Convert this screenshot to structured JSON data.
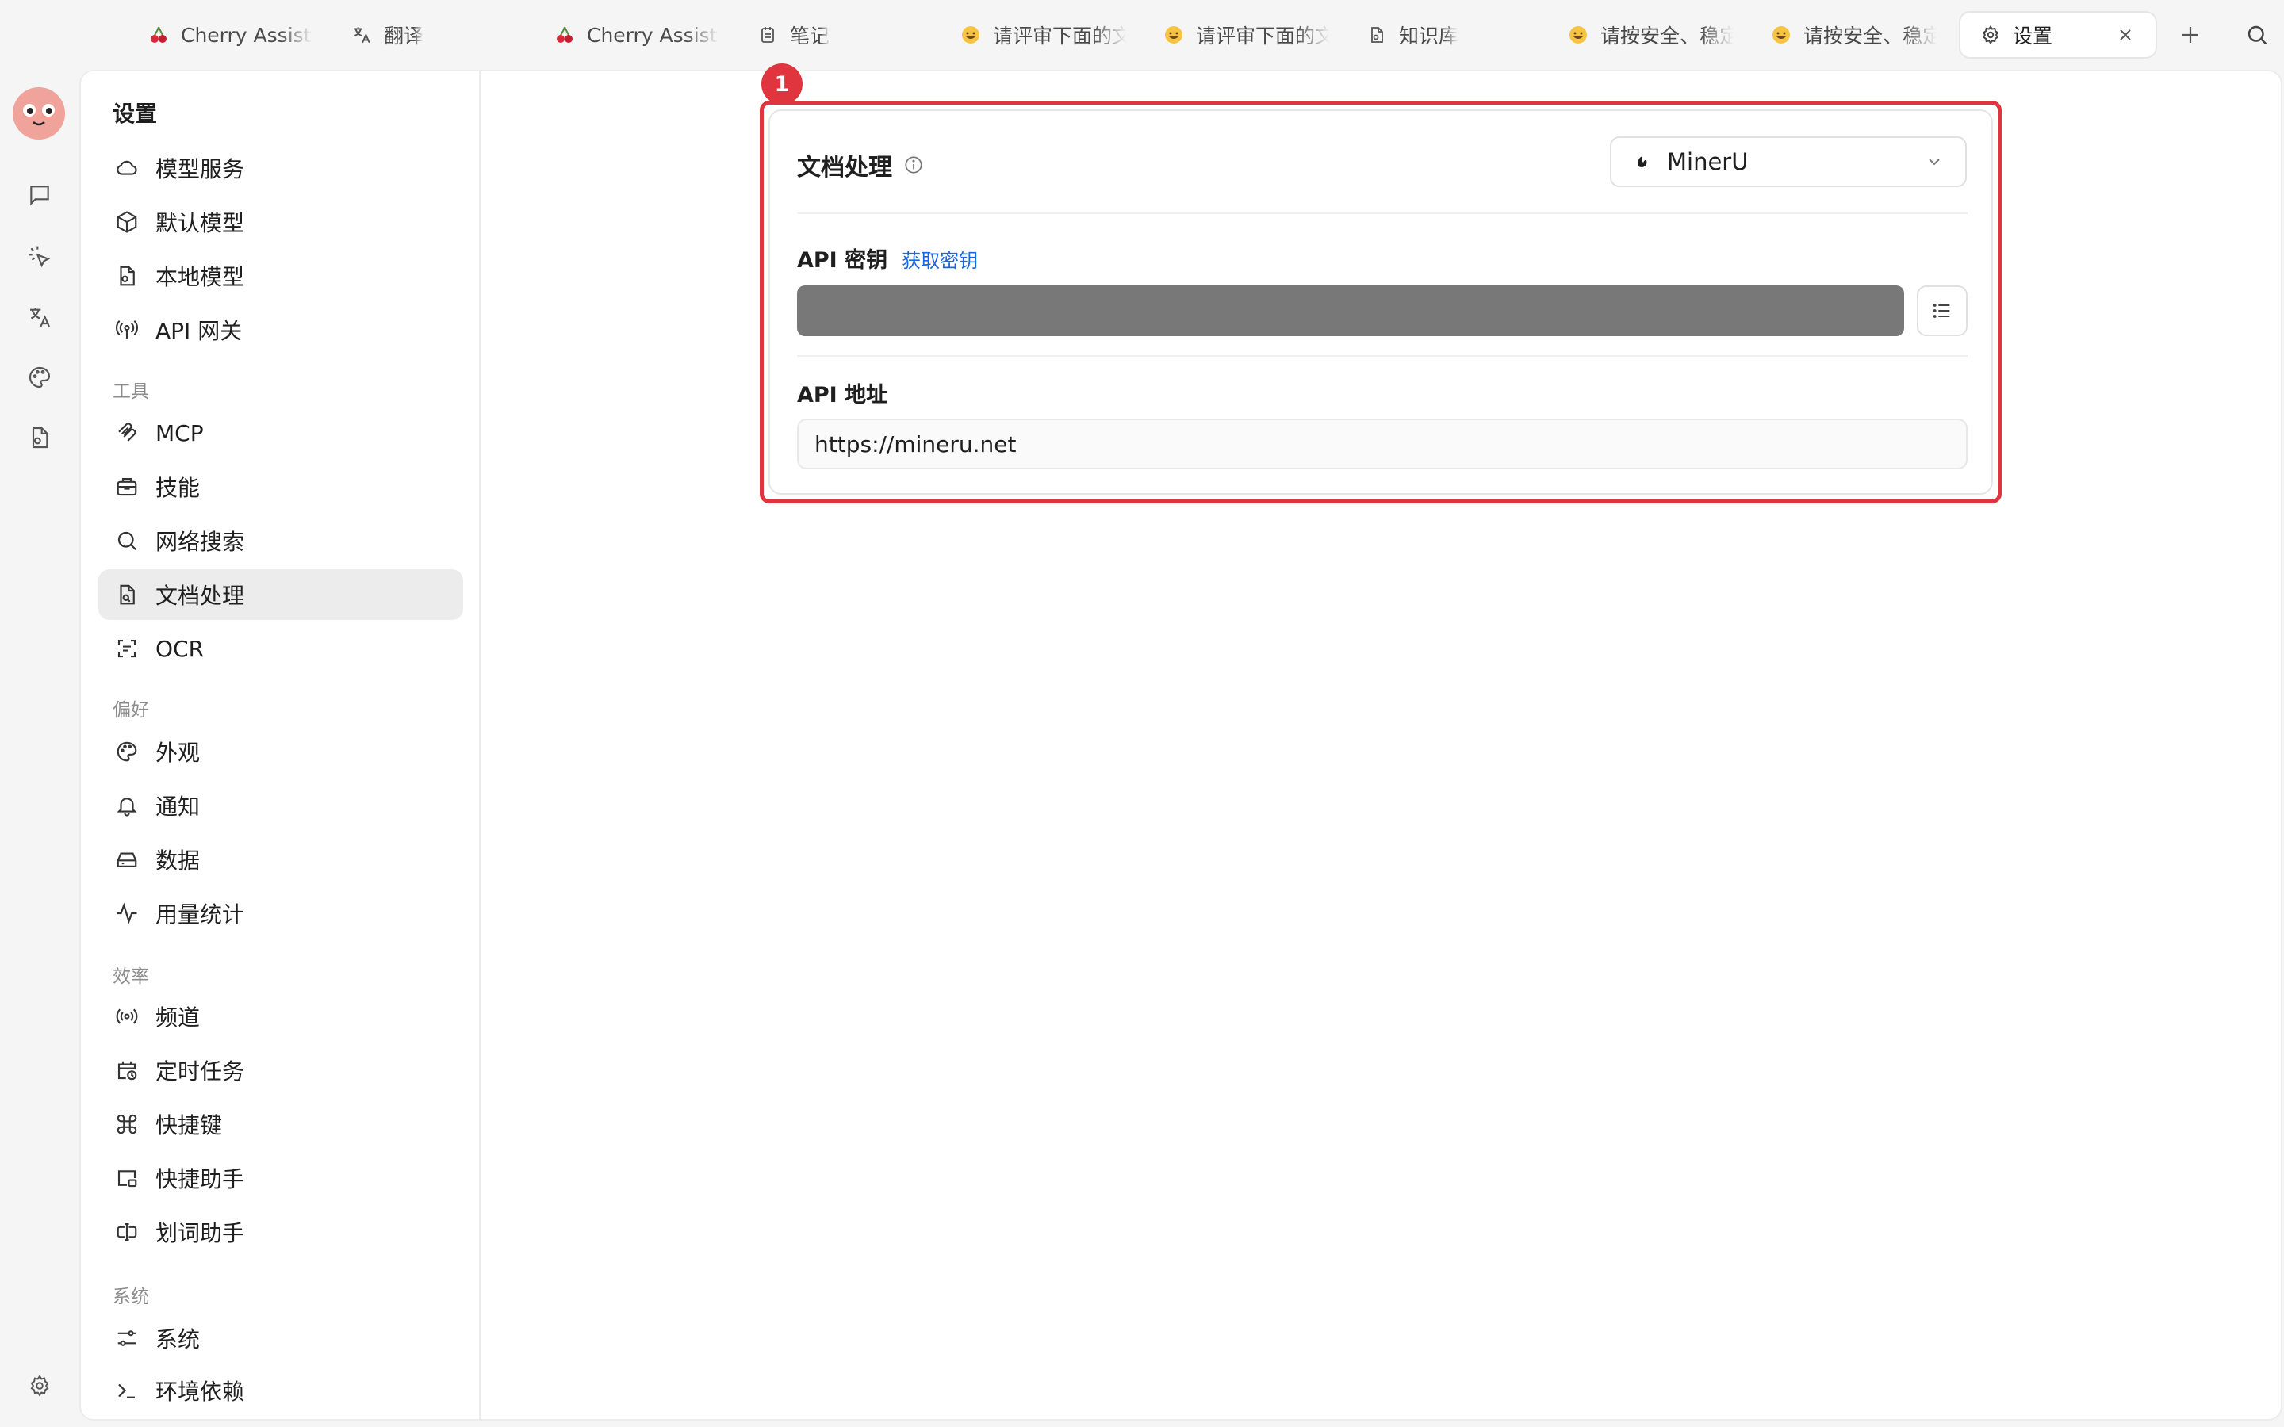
{
  "tabs": [
    {
      "label": "Cherry Assistant",
      "icon": "cherry-icon"
    },
    {
      "label": "翻译",
      "icon": "translate-icon"
    },
    {
      "label": "Cherry Assistant",
      "icon": "cherry-icon"
    },
    {
      "label": "笔记",
      "icon": "notes-icon"
    },
    {
      "label": "请评审下面的文",
      "icon": "grin-emoji-icon"
    },
    {
      "label": "请评审下面的文",
      "icon": "grin-emoji-icon"
    },
    {
      "label": "知识库",
      "icon": "knowledge-icon"
    },
    {
      "label": "请按安全、稳定",
      "icon": "grin-emoji-icon"
    },
    {
      "label": "请按安全、稳定",
      "icon": "grin-emoji-icon"
    },
    {
      "label": "设置",
      "icon": "gear-icon",
      "active": true
    }
  ],
  "nav": {
    "title": "设置",
    "items": [
      {
        "label": "模型服务",
        "icon": "cloud-icon"
      },
      {
        "label": "默认模型",
        "icon": "cube-icon"
      },
      {
        "label": "本地模型",
        "icon": "local-file-icon"
      },
      {
        "label": "API 网关",
        "icon": "antenna-icon"
      },
      {
        "label": "MCP",
        "icon": "mcp-icon"
      },
      {
        "label": "技能",
        "icon": "toolbox-icon"
      },
      {
        "label": "网络搜索",
        "icon": "search-icon"
      },
      {
        "label": "文档处理",
        "icon": "document-icon",
        "active": true
      },
      {
        "label": "OCR",
        "icon": "scan-icon"
      },
      {
        "label": "外观",
        "icon": "palette-icon"
      },
      {
        "label": "通知",
        "icon": "bell-icon"
      },
      {
        "label": "数据",
        "icon": "drive-icon"
      },
      {
        "label": "用量统计",
        "icon": "activity-icon"
      },
      {
        "label": "频道",
        "icon": "broadcast-icon"
      },
      {
        "label": "定时任务",
        "icon": "calendar-clock-icon"
      },
      {
        "label": "快捷键",
        "icon": "command-icon"
      },
      {
        "label": "快捷助手",
        "icon": "window-icon"
      },
      {
        "label": "划词助手",
        "icon": "text-select-icon"
      },
      {
        "label": "系统",
        "icon": "sliders-icon"
      },
      {
        "label": "环境依赖",
        "icon": "terminal-icon"
      }
    ],
    "groups": [
      "工具",
      "偏好",
      "效率",
      "系统"
    ]
  },
  "content": {
    "badge": "1",
    "title": "文档处理",
    "provider": "MinerU",
    "api_key_label": "API 密钥",
    "get_key_link": "获取密钥",
    "api_url_label": "API 地址",
    "api_url_value": "https://mineru.net"
  },
  "colors": {
    "highlight": "#e0353f",
    "link": "#1a66e6",
    "active_bg": "#ececec"
  }
}
